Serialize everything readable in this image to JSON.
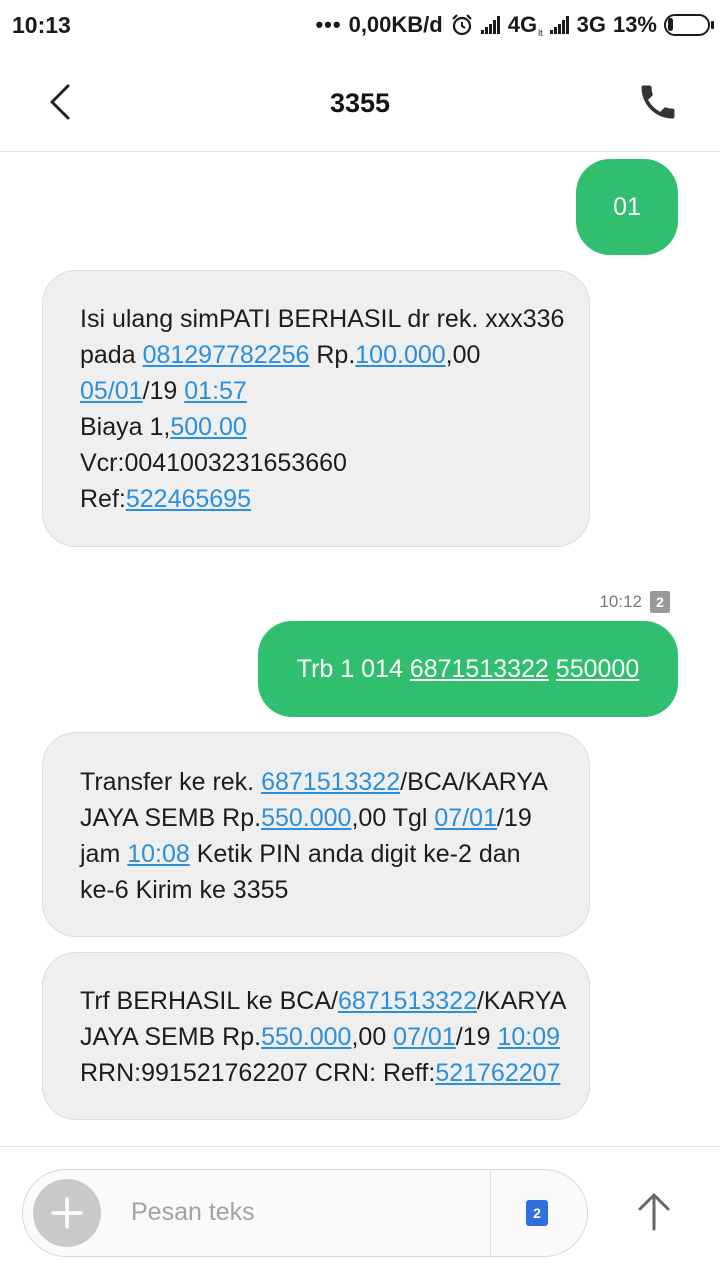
{
  "status_bar": {
    "time": "10:13",
    "dots": "•••",
    "data_rate": "0,00KB/d",
    "network1": "4G",
    "network1_sub": "lt",
    "network2": "3G",
    "battery": "13%"
  },
  "header": {
    "title": "3355"
  },
  "messages": [
    {
      "direction": "outgoing",
      "text": "01"
    },
    {
      "direction": "incoming",
      "lines": [
        [
          "Isi ulang simPATI BERHASIL dr rek. xxx336"
        ],
        [
          "pada ",
          "081297782256",
          " Rp.",
          "100.000",
          ",00"
        ],
        [
          "05/01",
          "/19 ",
          "01:57"
        ],
        [
          "Biaya 1,",
          "500.00"
        ],
        [
          "Vcr:0041003231653660"
        ],
        [
          "Ref:",
          "522465695"
        ]
      ]
    },
    {
      "direction": "outgoing",
      "timestamp": "10:12",
      "sim": "2",
      "parts": [
        "Trb  1 014 ",
        "6871513322",
        " ",
        "550000"
      ]
    },
    {
      "direction": "incoming",
      "lines": [
        [
          "Transfer ke rek. ",
          "6871513322",
          "/BCA/KARYA"
        ],
        [
          "JAYA SEMB Rp.",
          "550.000",
          ",00 Tgl ",
          "07/01",
          "/19"
        ],
        [
          "jam ",
          "10:08",
          " Ketik PIN anda digit ke-2 dan"
        ],
        [
          "ke-6 Kirim ke 3355"
        ]
      ]
    },
    {
      "direction": "incoming",
      "lines": [
        [
          "Trf BERHASIL ke BCA/",
          "6871513322",
          "/KARYA"
        ],
        [
          "JAYA SEMB Rp.",
          "550.000",
          ",00 ",
          "07/01",
          "/19 ",
          "10:09"
        ],
        [
          "RRN:991521762207 CRN: Reff:",
          "521762207"
        ]
      ]
    }
  ],
  "compose": {
    "placeholder": "Pesan teks",
    "sim": "2"
  },
  "colors": {
    "outgoing_bubble": "#2fbf6e",
    "incoming_bubble": "#efefef",
    "link": "#2b8fe0",
    "sim_button": "#2f6fe0"
  },
  "icons": {
    "back": "chevron-left-icon",
    "call": "phone-icon",
    "add": "plus-icon",
    "send": "arrow-up-icon",
    "alarm": "alarm-clock-icon"
  }
}
